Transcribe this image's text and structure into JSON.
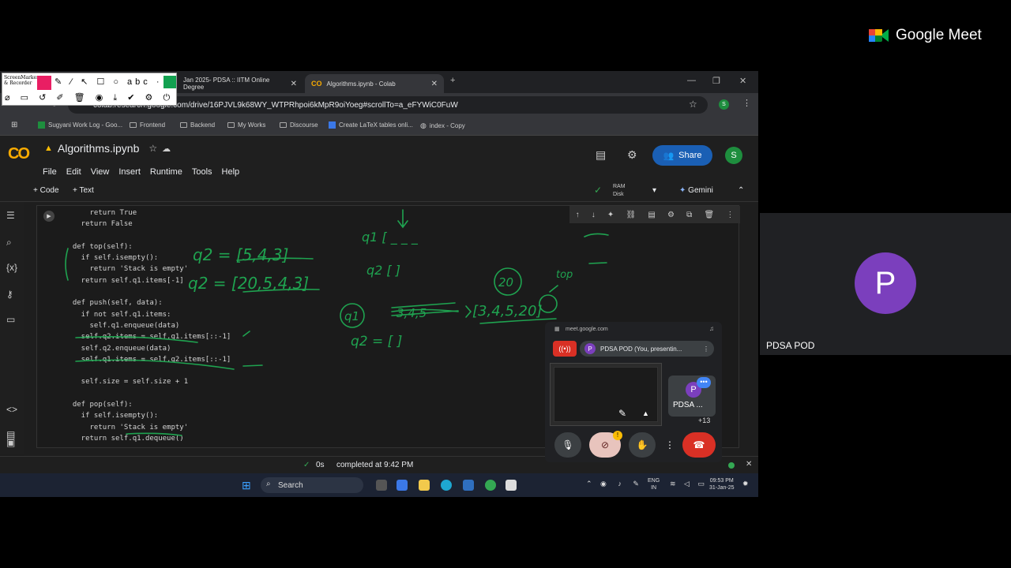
{
  "meet": {
    "logo_text": "Google Meet",
    "participant_initial": "P",
    "participant_name": "PDSA POD"
  },
  "browser": {
    "tabs": [
      {
        "label": "Jan 2025- PDSA :: IITM Online Degree"
      },
      {
        "label": "Algorithms.ipynb - Colab"
      }
    ],
    "url": "colab.research.google.com/drive/16PJVL9k68WY_WTPRhpoi6kMpR9oiYoeg#scrollTo=a_eFYWiC0FuW",
    "bookmarks": [
      "Sugyani Work Log - Goo...",
      "Frontend",
      "Backend",
      "My Works",
      "Discourse",
      "Create LaTeX tables onli...",
      "index - Copy"
    ],
    "annotator": {
      "line1": "ScreenMarker",
      "line2": "& Recorder"
    }
  },
  "colab": {
    "logo": "CO",
    "notebook_title": "Algorithms.ipynb",
    "menu": [
      "File",
      "Edit",
      "View",
      "Insert",
      "Runtime",
      "Tools",
      "Help"
    ],
    "share_label": "Share",
    "user_initial": "S",
    "add_code": "+ Code",
    "add_text": "+ Text",
    "ram_label": "RAM",
    "disk_label": "Disk",
    "gemini_label": "Gemini",
    "status_time": "0s",
    "status_text": "completed at 9:42 PM"
  },
  "code_lines": [
    "      return True",
    "    return False",
    "",
    "  def top(self):",
    "    if self.isempty():",
    "      return 'Stack is empty'",
    "    return self.q1.items[-1]",
    "",
    "  def push(self, data):",
    "    if not self.q1.items:",
    "      self.q1.enqueue(data)",
    "    self.q2.items = self.q1.items[::-1]",
    "    self.q2.enqueue(data)",
    "    self.q1.items = self.q2.items[::-1]",
    "",
    "    self.size = self.size + 1",
    "",
    "  def pop(self):",
    "    if self.isempty():",
    "      return 'Stack is empty'",
    "    return self.q1.dequeue()"
  ],
  "handwriting": {
    "q2_first": "q2 = [5,4,3]",
    "q2_second": "q2 = [20,5,4,3]",
    "q1_top": "q1 [ _ _ _",
    "q2_empty": "q2 [ ]",
    "q1_label": "q1",
    "q1_struck": "3,4,5",
    "q1_new": "[3,4,5,20]",
    "circled": "20",
    "top_label": "top",
    "q2_bottom": "q2 = [ ]"
  },
  "taskbar": {
    "search_label": "Search",
    "lang_top": "ENG",
    "lang_bottom": "IN",
    "time": "09:53 PM",
    "date": "31-Jan-25"
  },
  "pip": {
    "url": "meet.google.com",
    "presenting_text": "PDSA POD (You, presentin...",
    "tile_initial": "P",
    "tile_name": "PDSA ...",
    "extra_count": "+13"
  }
}
